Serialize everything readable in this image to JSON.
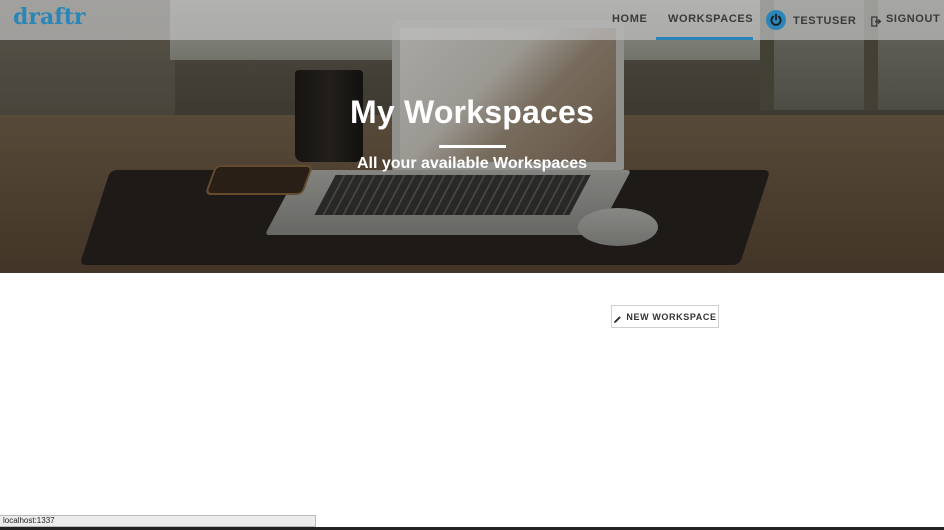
{
  "navbar": {
    "brand": "draftr",
    "links": {
      "home": "HOME",
      "workspaces": "WORKSPACES"
    },
    "active_link": "workspaces",
    "user": {
      "name": "TESTUSER",
      "icon": "power-icon"
    },
    "signout": {
      "label": "SIGNOUT",
      "icon": "signout-icon"
    }
  },
  "hero": {
    "title": "My Workspaces",
    "subtitle": "All your available Workspaces"
  },
  "main": {
    "new_workspace_button": {
      "label": "NEW WORKSPACE",
      "icon": "pencil-icon"
    }
  },
  "status_bar": {
    "text": "localhost:1337"
  },
  "colors": {
    "accent": "#2a86b8",
    "nav_text": "#3a3a3a",
    "hero_text": "#ffffff"
  }
}
